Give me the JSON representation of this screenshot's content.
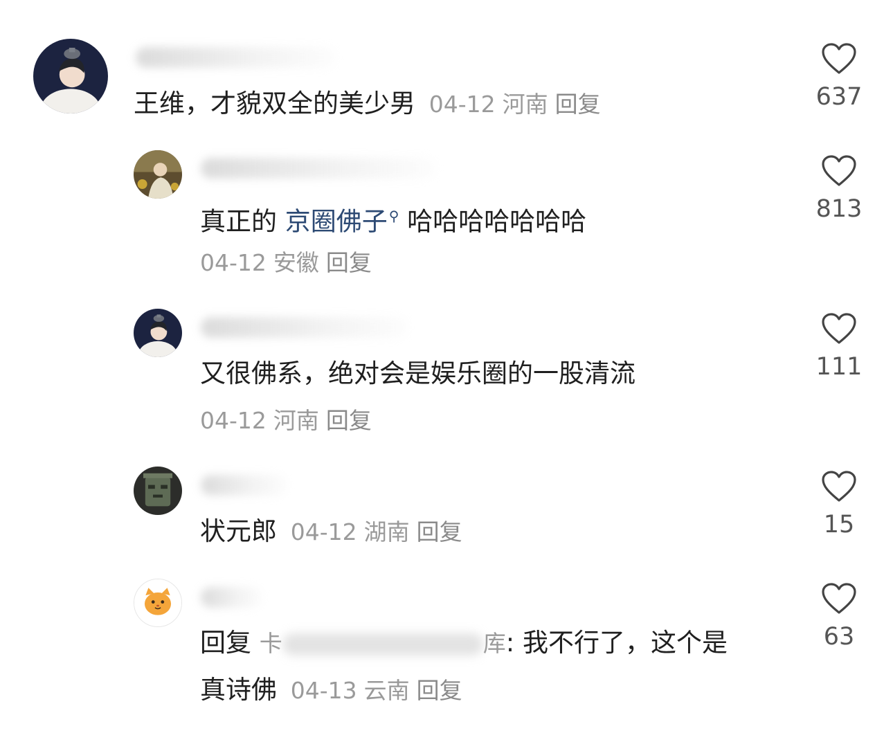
{
  "comments": [
    {
      "text": "王维，才貌双全的美少男",
      "date": "04-12",
      "location": "河南",
      "reply": "回复",
      "likes": "637",
      "avatar_icon": "portrait-avatar-icon"
    },
    {
      "text_before": "真正的 ",
      "keyword": "京圈佛子",
      "text_after": " 哈哈哈哈哈哈哈",
      "date": "04-12",
      "location": "安徽",
      "reply": "回复",
      "likes": "813",
      "avatar_icon": "painting-avatar-icon"
    },
    {
      "text": "又很佛系，绝对会是娱乐圈的一股清流",
      "date": "04-12",
      "location": "河南",
      "reply": "回复",
      "likes": "111",
      "avatar_icon": "portrait-avatar-icon"
    },
    {
      "text": "状元郎",
      "date": "04-12",
      "location": "湖南",
      "reply": "回复",
      "likes": "15",
      "avatar_icon": "bronze-mask-avatar-icon"
    },
    {
      "reply_prefix": "回复 ",
      "reply_target_start": "卡",
      "reply_target_end": "库",
      "text_line1": ": 我不行了，这个是",
      "text_line2": "真诗佛",
      "date": "04-13",
      "location": "云南",
      "reply": "回复",
      "likes": "63",
      "avatar_icon": "cat-avatar-icon"
    }
  ],
  "colors": {
    "text": "#1f1f1f",
    "meta": "#9a9a9a",
    "keyword": "#2d4a74",
    "heart_outline": "#444444"
  }
}
